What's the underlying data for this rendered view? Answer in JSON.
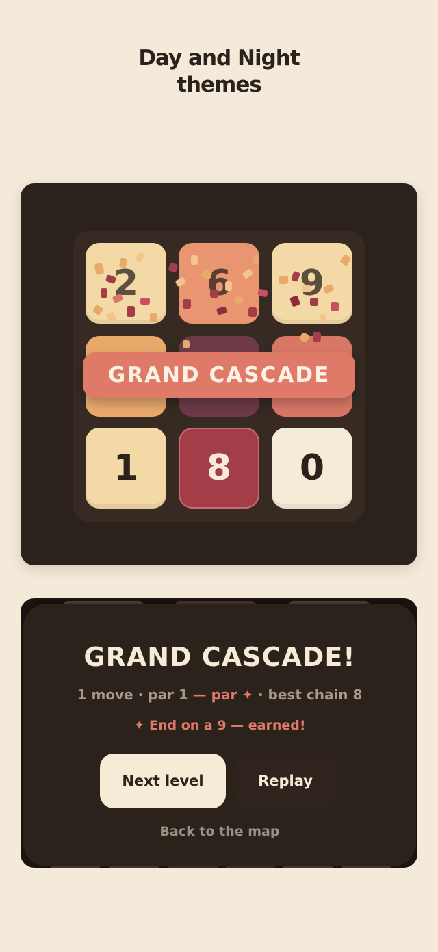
{
  "headline": {
    "line1": "Day and Night",
    "line2": "themes"
  },
  "board": {
    "rows": [
      [
        {
          "value": "2",
          "style": "cream"
        },
        {
          "value": "6",
          "style": "salmon"
        },
        {
          "value": "9",
          "style": "cream"
        }
      ],
      [
        {
          "value": "",
          "style": "orange"
        },
        {
          "value": "",
          "style": "plum"
        },
        {
          "value": "",
          "style": "coral"
        }
      ],
      [
        {
          "value": "1",
          "style": "cream"
        },
        {
          "value": "8",
          "style": "crimson"
        },
        {
          "value": "0",
          "style": "white"
        }
      ]
    ],
    "banner": "GRAND CASCADE"
  },
  "result": {
    "title": "GRAND CASCADE!",
    "stats_prefix": "1 move · par 1",
    "stats_highlight": " — par ✦",
    "stats_suffix": " · best chain 8",
    "earned": "✦ End on a 9 — earned!",
    "next_label": "Next level",
    "replay_label": "Replay",
    "back_label": "Back to the map"
  },
  "colors": {
    "background": "#f3ead9",
    "card": "#2c221c",
    "accent": "#df7a68",
    "cream_tile": "#f3d9a6",
    "crimson_tile": "#a33e49"
  }
}
